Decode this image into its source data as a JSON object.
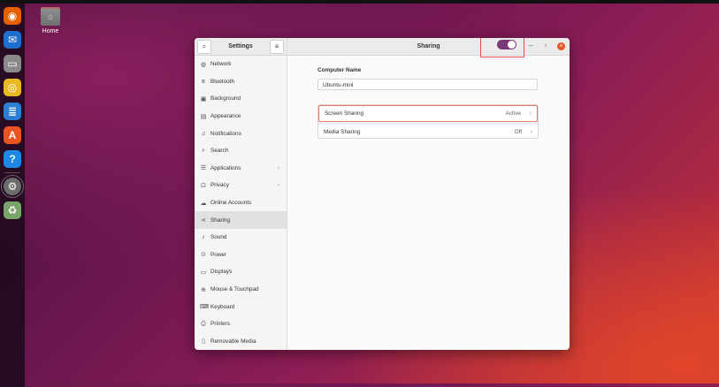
{
  "desktop": {
    "home_label": "Home",
    "dock": [
      {
        "name": "firefox-icon",
        "glyph": "◉",
        "color": "#e66000"
      },
      {
        "name": "thunderbird-icon",
        "glyph": "✉",
        "color": "#1f6fd1"
      },
      {
        "name": "files-icon",
        "glyph": "▭",
        "color": "#8a8a8a"
      },
      {
        "name": "rhythmbox-icon",
        "glyph": "◎",
        "color": "#e8b923"
      },
      {
        "name": "writer-icon",
        "glyph": "≣",
        "color": "#2a7fd4"
      },
      {
        "name": "app-center-icon",
        "glyph": "A",
        "color": "#e95420"
      },
      {
        "name": "help-icon",
        "glyph": "?",
        "color": "#1e88e5"
      },
      {
        "name": "settings-icon",
        "glyph": "⚙",
        "color": "#6d6d6d"
      },
      {
        "name": "trash-icon",
        "glyph": "♻",
        "color": "#7aa56a"
      }
    ]
  },
  "sidebar": {
    "title": "Settings",
    "items": [
      {
        "label": "Network",
        "icon": "◍"
      },
      {
        "label": "Bluetooth",
        "icon": "ʙ"
      },
      {
        "label": "Background",
        "icon": "▣"
      },
      {
        "label": "Appearance",
        "icon": "▤"
      },
      {
        "label": "Notifications",
        "icon": "♫"
      },
      {
        "label": "Search",
        "icon": "⌕"
      },
      {
        "label": "Applications",
        "icon": "☰",
        "chevron": "›"
      },
      {
        "label": "Privacy",
        "icon": "⊡",
        "chevron": "›"
      },
      {
        "label": "Online Accounts",
        "icon": "☁"
      },
      {
        "label": "Sharing",
        "icon": "⋖"
      },
      {
        "label": "Sound",
        "icon": "♪"
      },
      {
        "label": "Power",
        "icon": "⊙"
      },
      {
        "label": "Displays",
        "icon": "▭"
      },
      {
        "label": "Mouse & Touchpad",
        "icon": "⊕"
      },
      {
        "label": "Keyboard",
        "icon": "⌨"
      },
      {
        "label": "Printers",
        "icon": "⎙"
      },
      {
        "label": "Removable Media",
        "icon": "▯"
      }
    ],
    "selected": "Sharing"
  },
  "panel": {
    "title": "Sharing",
    "toggle_on": true,
    "minimize": "–",
    "maximize": "▫",
    "close": "×",
    "computer_name_label": "Computer Name",
    "computer_name_value": "Ubuntu-mini",
    "rows": [
      {
        "label": "Screen Sharing",
        "status": "Active",
        "arrow": "›"
      },
      {
        "label": "Media Sharing",
        "status": "Off",
        "arrow": "›"
      }
    ]
  }
}
